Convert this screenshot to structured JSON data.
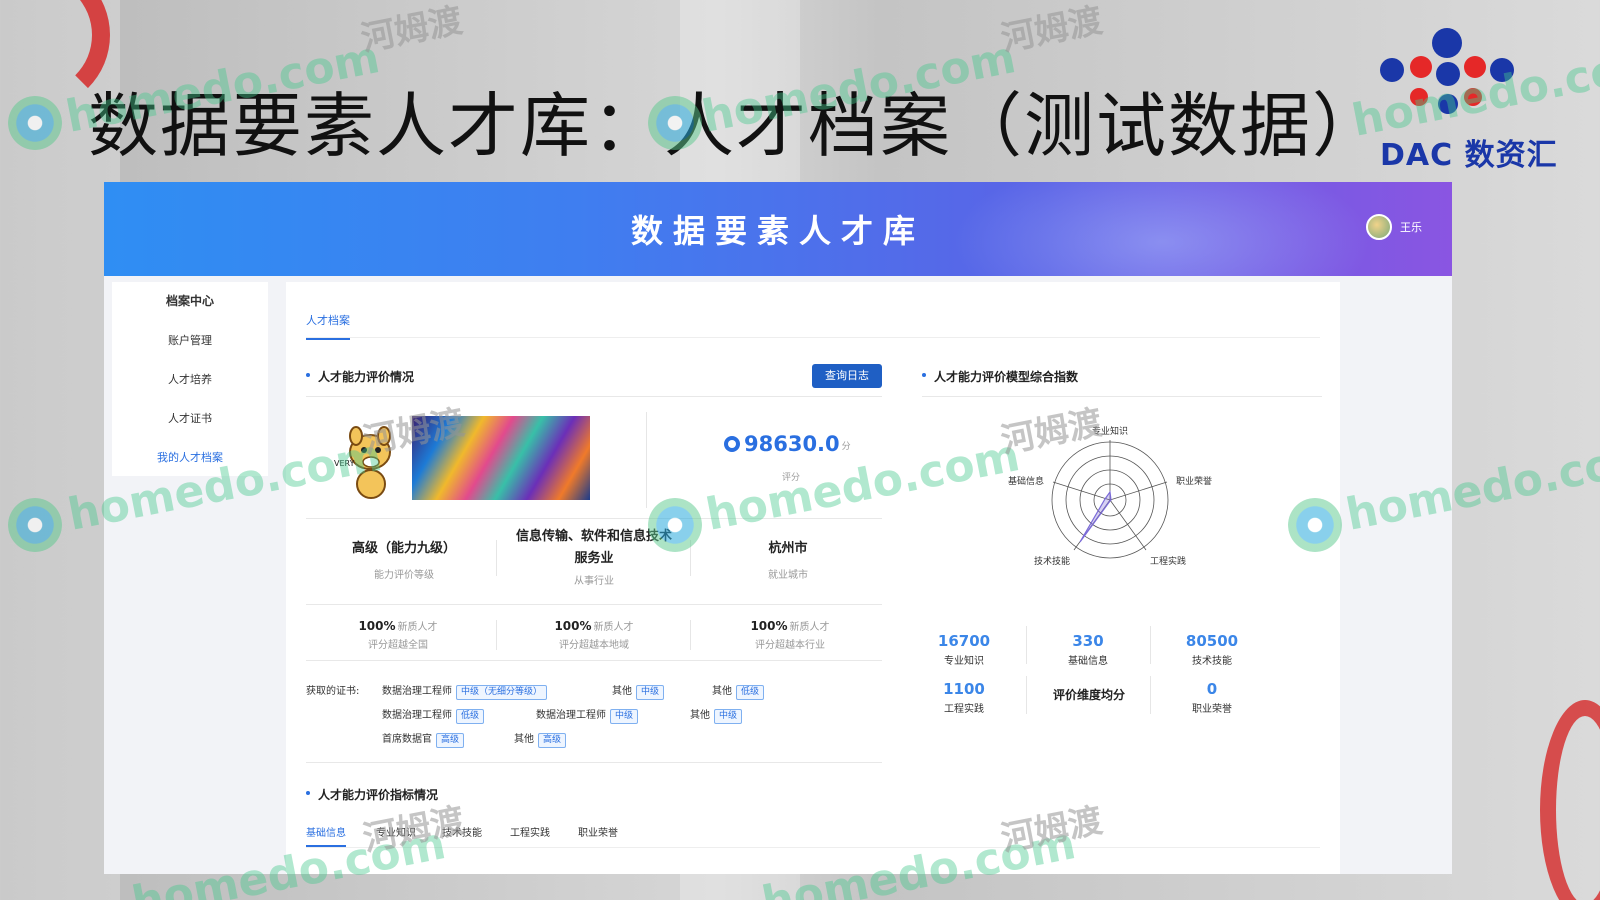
{
  "slide": {
    "title": "数据要素人才库：人才档案（测试数据）",
    "logo_text": "DAC 数资汇"
  },
  "colors": {
    "accent": "#2a6fe0",
    "button": "#1f5fc4",
    "metric": "#3b86e8"
  },
  "banner": {
    "title": "数据要素人才库",
    "user_name": "王乐"
  },
  "sidebar": {
    "items": [
      {
        "label": "档案中心"
      },
      {
        "label": "账户管理"
      },
      {
        "label": "人才培养"
      },
      {
        "label": "人才证书"
      },
      {
        "label": "我的人才档案"
      }
    ]
  },
  "main": {
    "tab": "人才档案",
    "eval_title": "人才能力评价情况",
    "log_button": "查询日志",
    "mascot_text": "VERY",
    "score": {
      "value": "98630.0",
      "unit": "分",
      "label": "评分"
    },
    "stats": [
      {
        "value": "高级（能力九级）",
        "label": "能力评价等级"
      },
      {
        "value": "信息传输、软件和信息技术服务业",
        "label": "从事行业"
      },
      {
        "value": "杭州市",
        "label": "就业城市"
      }
    ],
    "percentiles": [
      {
        "value": "100%",
        "tag": "新质人才",
        "label": "评分超越全国"
      },
      {
        "value": "100%",
        "tag": "新质人才",
        "label": "评分超越本地域"
      },
      {
        "value": "100%",
        "tag": "新质人才",
        "label": "评分超越本行业"
      }
    ],
    "cert_label": "获取的证书:",
    "certs": [
      {
        "name": "数据治理工程师",
        "level": "中级（无细分等级）"
      },
      {
        "name": "其他",
        "level": "中级"
      },
      {
        "name": "其他",
        "level": "低级"
      },
      {
        "name": "数据治理工程师",
        "level": "低级"
      },
      {
        "name": "数据治理工程师",
        "level": "中级"
      },
      {
        "name": "其他",
        "level": "中级"
      },
      {
        "name": "首席数据官",
        "level": "高级"
      },
      {
        "name": "其他",
        "level": "高级"
      }
    ],
    "model_title": "人才能力评价模型综合指数",
    "radar_axes": [
      "专业知识",
      "职业荣誉",
      "工程实践",
      "技术技能",
      "基础信息"
    ],
    "dimensions": [
      {
        "value": "16700",
        "label": "专业知识"
      },
      {
        "value": "330",
        "label": "基础信息"
      },
      {
        "value": "80500",
        "label": "技术技能"
      },
      {
        "value": "1100",
        "label": "工程实践"
      },
      {
        "value": "0",
        "label": "职业荣誉"
      }
    ],
    "dimension_center": "评价维度均分",
    "index_title": "人才能力评价指标情况",
    "sub_tabs": [
      "基础信息",
      "专业知识",
      "技术技能",
      "工程实践",
      "职业荣誉"
    ]
  },
  "watermark": {
    "domain": "homedo.com",
    "cn": "河姆渡"
  }
}
